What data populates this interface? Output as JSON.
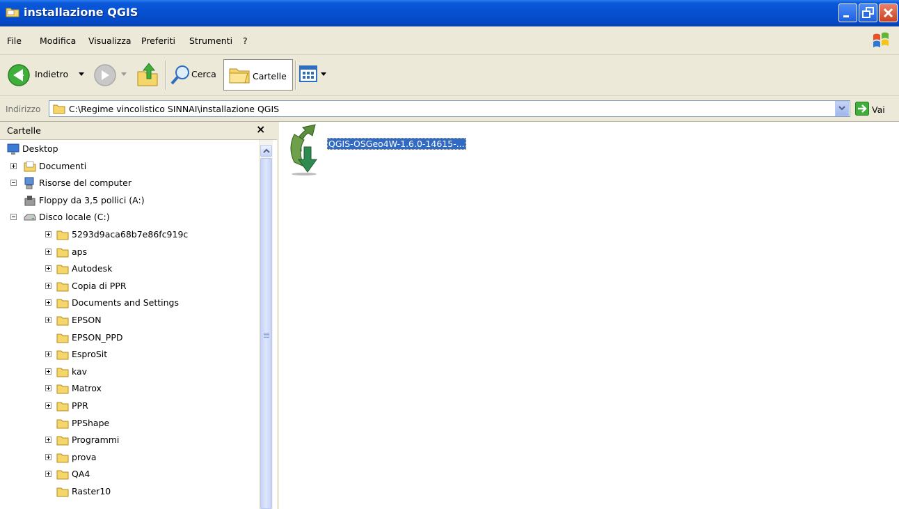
{
  "window": {
    "title": "installazione QGIS"
  },
  "menu": {
    "items": [
      "File",
      "Modifica",
      "Visualizza",
      "Preferiti",
      "Strumenti",
      "?"
    ]
  },
  "toolbar": {
    "back_label": "Indietro",
    "search_label": "Cerca",
    "folders_label": "Cartelle"
  },
  "address": {
    "label": "Indirizzo",
    "path": "C:\\Regime vincolistico SINNAI\\installazione QGIS",
    "go_label": "Vai"
  },
  "folders_pane": {
    "title": "Cartelle",
    "close_glyph": "×",
    "tree": [
      {
        "label": "Desktop",
        "level": 0,
        "toggle": "none",
        "icon": "desktop-icon"
      },
      {
        "label": "Documenti",
        "level": 1,
        "toggle": "plus",
        "icon": "documents-icon"
      },
      {
        "label": "Risorse del computer",
        "level": 1,
        "toggle": "minus",
        "icon": "computer-icon"
      },
      {
        "label": "Floppy da 3,5 pollici (A:)",
        "level": 2,
        "toggle": "none",
        "icon": "floppy-icon"
      },
      {
        "label": "Disco locale (C:)",
        "level": 2,
        "toggle": "minus",
        "icon": "drive-icon"
      },
      {
        "label": "5293d9aca68b7e86fc919c",
        "level": 3,
        "toggle": "plus",
        "icon": "folder-icon"
      },
      {
        "label": "aps",
        "level": 3,
        "toggle": "plus",
        "icon": "folder-icon"
      },
      {
        "label": "Autodesk",
        "level": 3,
        "toggle": "plus",
        "icon": "folder-icon"
      },
      {
        "label": "Copia di PPR",
        "level": 3,
        "toggle": "plus",
        "icon": "folder-icon"
      },
      {
        "label": "Documents and Settings",
        "level": 3,
        "toggle": "plus",
        "icon": "folder-icon"
      },
      {
        "label": "EPSON",
        "level": 3,
        "toggle": "plus",
        "icon": "folder-icon"
      },
      {
        "label": "EPSON_PPD",
        "level": 3,
        "toggle": "none",
        "icon": "folder-icon"
      },
      {
        "label": "EsproSit",
        "level": 3,
        "toggle": "plus",
        "icon": "folder-icon"
      },
      {
        "label": "kav",
        "level": 3,
        "toggle": "plus",
        "icon": "folder-icon"
      },
      {
        "label": "Matrox",
        "level": 3,
        "toggle": "plus",
        "icon": "folder-icon"
      },
      {
        "label": "PPR",
        "level": 3,
        "toggle": "plus",
        "icon": "folder-icon"
      },
      {
        "label": "PPShape",
        "level": 3,
        "toggle": "none",
        "icon": "folder-icon"
      },
      {
        "label": "Programmi",
        "level": 3,
        "toggle": "plus",
        "icon": "folder-icon"
      },
      {
        "label": "prova",
        "level": 3,
        "toggle": "plus",
        "icon": "folder-icon"
      },
      {
        "label": "QA4",
        "level": 3,
        "toggle": "plus",
        "icon": "folder-icon"
      },
      {
        "label": "Raster10",
        "level": 3,
        "toggle": "none",
        "icon": "folder-icon"
      }
    ]
  },
  "content": {
    "files": [
      {
        "name": "QGIS-OSGeo4W-1.6.0-14615-...",
        "icon": "qgis-installer-icon",
        "selected": true
      }
    ]
  },
  "colors": {
    "title_bar": "#0550d0",
    "selection": "#316ac5",
    "folder_yellow": "#f5d66a"
  }
}
